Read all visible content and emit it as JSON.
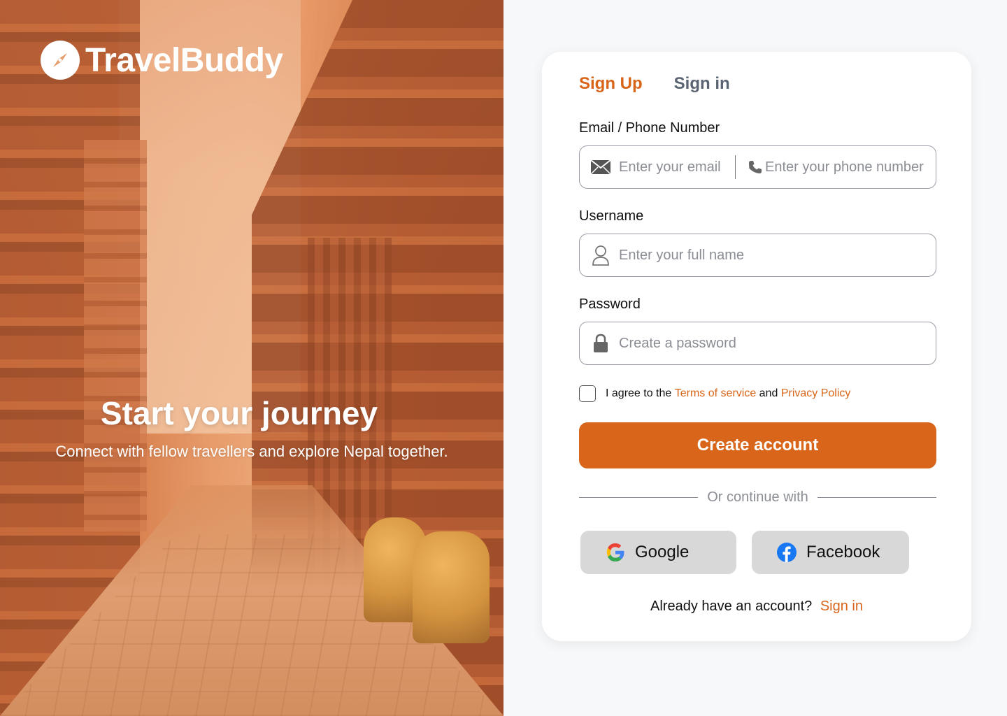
{
  "brand": {
    "name": "TravelBuddy",
    "logo_icon": "compass-icon"
  },
  "hero": {
    "title": "Start your journey",
    "subtitle": "Connect with fellow travellers and explore Nepal together."
  },
  "tabs": {
    "signup": "Sign Up",
    "signin": "Sign in"
  },
  "form": {
    "contact_label": "Email / Phone Number",
    "email_placeholder": "Enter your email",
    "phone_placeholder": "Enter your phone number",
    "username_label": "Username",
    "username_placeholder": "Enter your full name",
    "password_label": "Password",
    "password_placeholder": "Create a password",
    "agree_prefix": "I agree to the",
    "terms": "Terms of service",
    "and": "and",
    "privacy": "Privacy Policy",
    "submit": "Create account"
  },
  "divider_text": "Or continue with",
  "social": {
    "google": "Google",
    "facebook": "Facebook"
  },
  "footer": {
    "question": "Already have an account?",
    "signin": "Sign in"
  },
  "colors": {
    "accent": "#D86519",
    "tab_inactive": "#5B6472",
    "social_bg": "#D8D8D8"
  }
}
